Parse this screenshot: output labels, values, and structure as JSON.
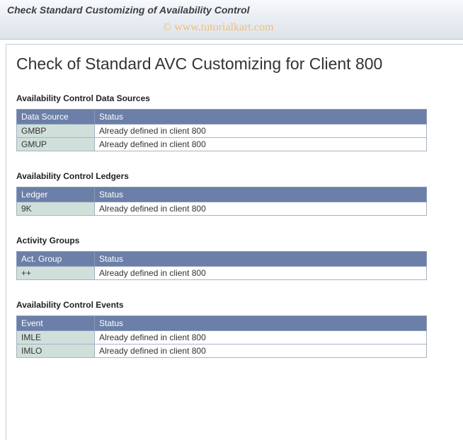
{
  "header": {
    "title": "Check Standard Customizing of Availability Control"
  },
  "watermark": "© www.tutorialkart.com",
  "page": {
    "title": "Check of Standard AVC Customizing for Client 800"
  },
  "sections": {
    "dataSources": {
      "heading": "Availability Control Data Sources",
      "col1": "Data Source",
      "col2": "Status",
      "rows": [
        {
          "key": "GMBP",
          "status": "Already defined in client 800"
        },
        {
          "key": "GMUP",
          "status": "Already defined in client 800"
        }
      ]
    },
    "ledgers": {
      "heading": "Availability Control Ledgers",
      "col1": "Ledger",
      "col2": "Status",
      "rows": [
        {
          "key": "9K",
          "status": "Already defined in client 800"
        }
      ]
    },
    "activityGroups": {
      "heading": "Activity Groups",
      "col1": "Act. Group",
      "col2": "Status",
      "rows": [
        {
          "key": "++",
          "status": "Already defined in client 800"
        }
      ]
    },
    "events": {
      "heading": "Availability Control Events",
      "col1": "Event",
      "col2": "Status",
      "rows": [
        {
          "key": "IMLE",
          "status": "Already defined in client 800"
        },
        {
          "key": "IMLO",
          "status": "Already defined in client 800"
        }
      ]
    }
  }
}
